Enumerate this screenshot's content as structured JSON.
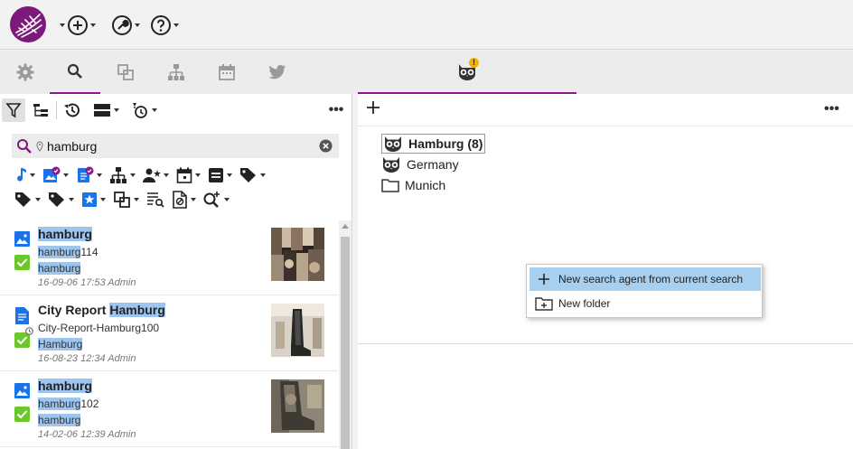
{
  "toolbar": {
    "logo_icon": "flower-logo",
    "items": [
      {
        "icon": "plus-circle-icon"
      },
      {
        "icon": "wrench-icon"
      },
      {
        "icon": "help-icon"
      }
    ]
  },
  "tabs": [
    {
      "icon": "gear-icon"
    },
    {
      "icon": "search-icon",
      "active": true
    },
    {
      "icon": "collection-icon"
    },
    {
      "icon": "hierarchy-icon"
    },
    {
      "icon": "calendar-icon"
    },
    {
      "icon": "twitter-icon"
    }
  ],
  "right_tab": {
    "icon": "owl-alert-icon",
    "badge": "!"
  },
  "search": {
    "query": "hamburg",
    "placeholder": ""
  },
  "results": [
    {
      "type": "image",
      "title": "hamburg",
      "title_prefix": "",
      "filename_hl": "hamburg",
      "filename_rest": "114",
      "tag": "hamburg",
      "meta": "16-09-06 17:53 Admin"
    },
    {
      "type": "document",
      "title_prefix": "City Report ",
      "title": "Hamburg",
      "filename_hl": "",
      "filename_rest": "City-Report-Hamburg100",
      "tag": "Hamburg",
      "meta": "16-08-23 12:34 Admin"
    },
    {
      "type": "image",
      "title": "hamburg",
      "title_prefix": "",
      "filename_hl": "hamburg",
      "filename_rest": "102",
      "tag": "hamburg",
      "meta": "14-02-06 12:39 Admin"
    }
  ],
  "tree": [
    {
      "label": "Hamburg (8)",
      "icon": "owl-icon",
      "selected": true
    },
    {
      "label": "Germany",
      "icon": "owl-icon"
    },
    {
      "label": "Munich",
      "icon": "folder-icon"
    }
  ],
  "context_menu": {
    "items": [
      {
        "label": "New search agent from current search",
        "icon": "plus-icon",
        "highlighted": true
      },
      {
        "label": "New folder",
        "icon": "folder-plus-icon"
      }
    ]
  },
  "colors": {
    "accent": "#8a1a8a",
    "highlight": "#9ec5ef",
    "menu_hover": "#a6cff0",
    "check": "#6cc72b",
    "icon_blue": "#1a73e8"
  }
}
